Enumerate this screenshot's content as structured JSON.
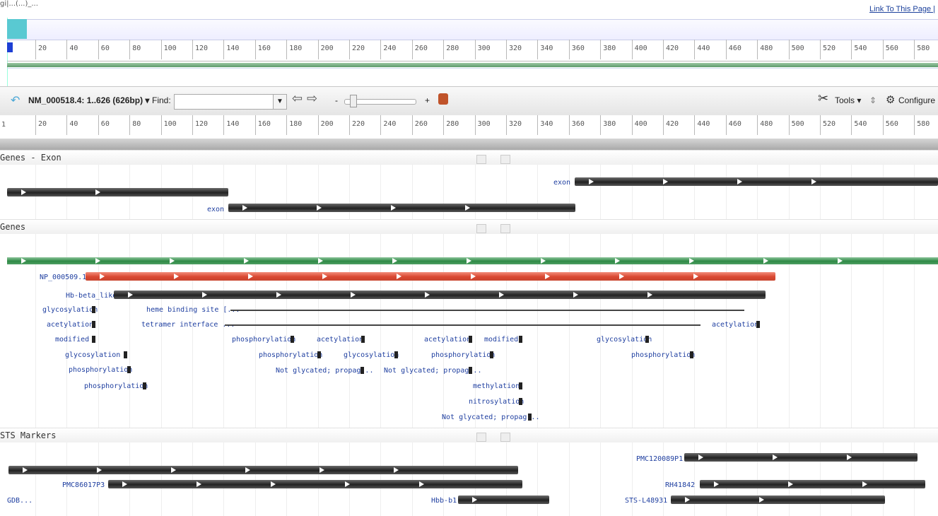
{
  "header": {
    "top_text": "gi|...(...)_...",
    "link": "Link To This Page |"
  },
  "overview": {
    "ticks": [
      "20",
      "40",
      "60",
      "80",
      "100",
      "120",
      "140",
      "160",
      "180",
      "200",
      "220",
      "240",
      "260",
      "280",
      "300",
      "320",
      "340",
      "360",
      "380",
      "400",
      "420",
      "440",
      "460",
      "480",
      "500",
      "520",
      "540",
      "560",
      "580"
    ]
  },
  "toolbar": {
    "sequence": "NM_000518.4: 1..626 (626bp)",
    "find_label": "Find:",
    "find_value": "",
    "zoom_minus": "-",
    "zoom_plus": "+",
    "tools_label": "Tools",
    "configure_label": "Configure"
  },
  "ruler": {
    "start": "1",
    "ticks": [
      "20",
      "40",
      "60",
      "80",
      "100",
      "120",
      "140",
      "160",
      "180",
      "200",
      "220",
      "240",
      "260",
      "280",
      "300",
      "320",
      "340",
      "360",
      "380",
      "400",
      "420",
      "440",
      "460",
      "480",
      "500",
      "520",
      "540",
      "560",
      "580"
    ]
  },
  "tracks": {
    "genes_exon": {
      "title": "Genes - Exon",
      "exon1": "exon",
      "exon2": "exon"
    },
    "genes": {
      "title": "Genes",
      "np": "NP_000509.1",
      "hb": "Hb-beta_like",
      "labels_left": [
        "glycosylation",
        "acetylation",
        "modified",
        "glycosylation",
        "phosphorylation",
        "phosphorylation"
      ],
      "heme": "heme binding site [...",
      "tetramer": "tetramer interface ...",
      "mid_labels": [
        "phosphorylation",
        "acetylation",
        "phosphorylation",
        "glycosylation",
        "Not glycated; propag...",
        "Not glycated; propag...",
        "acetylation",
        "modified",
        "phosphorylation",
        "methylation",
        "nitrosylation",
        "Not glycated; propag...",
        "glycosylation",
        "phosphorylation",
        "acetylation"
      ]
    },
    "sts": {
      "title": "STS Markers",
      "m1": "PMC120089P1",
      "m2": "PMC86017P3",
      "m3": "RH41842",
      "m4": "GDB...",
      "m5": "Hbb-b1",
      "m6": "STS-L48931"
    }
  },
  "colors": {
    "accent": "#59c9d2",
    "red_bar": "#d94731",
    "green_bar": "#2e8a45",
    "link": "#1a3f9b"
  }
}
